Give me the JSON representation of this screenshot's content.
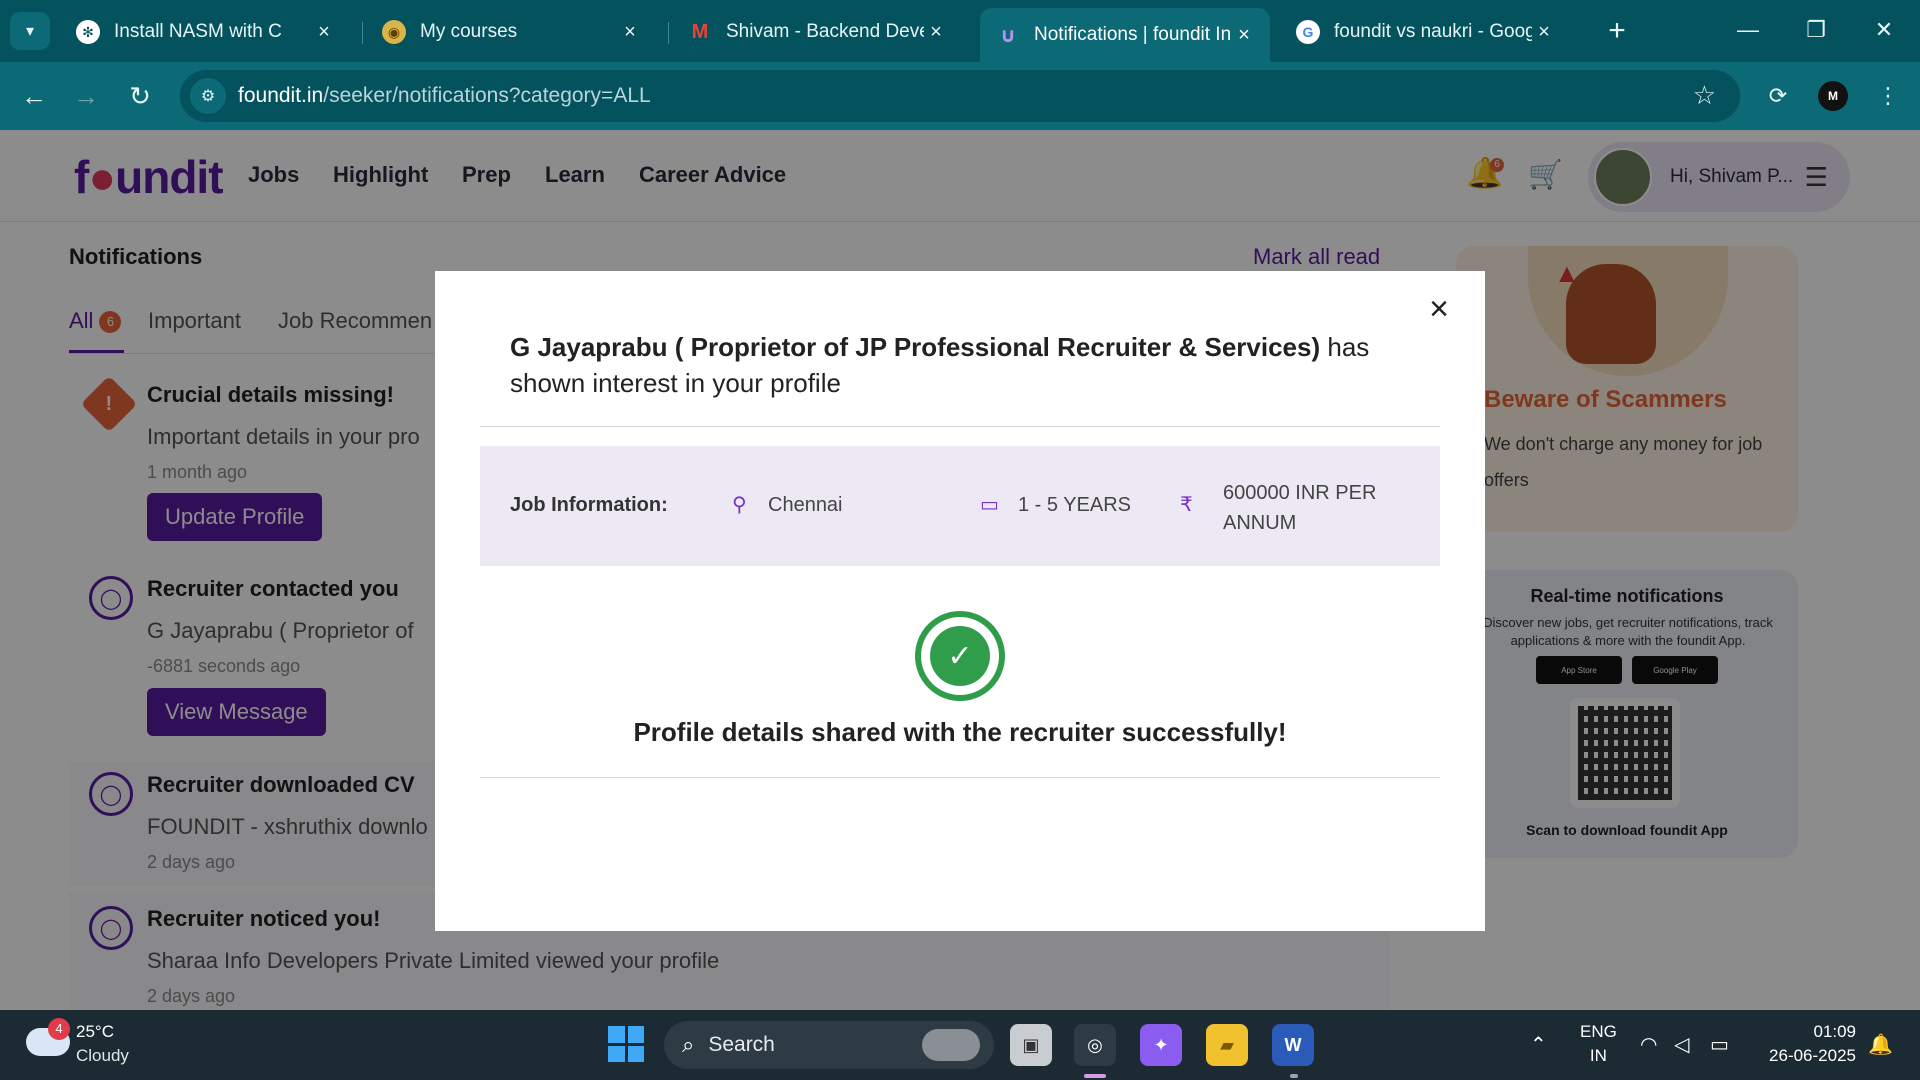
{
  "browser": {
    "tabs": [
      {
        "title": "Install NASM with C",
        "favicon": "openai-icon",
        "active": false
      },
      {
        "title": "My courses",
        "favicon": "courses-icon",
        "active": false
      },
      {
        "title": "Shivam - Backend Develo",
        "favicon": "gmail-icon",
        "active": false
      },
      {
        "title": "Notifications | foundit Inc",
        "favicon": "foundit-icon",
        "active": true
      },
      {
        "title": "foundit vs naukri - Googl",
        "favicon": "google-icon",
        "active": false
      }
    ],
    "url_host": "foundit.in",
    "url_path": "/seeker/notifications?category=ALL"
  },
  "site": {
    "logo": {
      "pre": "f",
      "dot": "●",
      "post": "undit"
    },
    "nav": [
      "Jobs",
      "Highlight",
      "Prep",
      "Learn",
      "Career Advice"
    ],
    "bell_count": "6",
    "greeting": "Hi, Shivam P..."
  },
  "notifications": {
    "title": "Notifications",
    "mark_all_read": "Mark all read",
    "tabs": {
      "all": "All",
      "all_count": "6",
      "important": "Important",
      "job_recs": "Job Recommen"
    },
    "items": [
      {
        "icon": "warning-icon",
        "head": "Crucial details missing!",
        "body": "Important details in your pro",
        "time": "1 month ago",
        "button": "Update Profile"
      },
      {
        "icon": "user-icon",
        "head": "Recruiter contacted you",
        "body": "G Jayaprabu ( Proprietor of",
        "time": "-6881 seconds ago",
        "button": "View Message"
      },
      {
        "icon": "user-icon",
        "head": "Recruiter downloaded CV",
        "body": "FOUNDIT - xshruthix downlo",
        "time": "2 days ago"
      },
      {
        "icon": "user-icon",
        "head": "Recruiter noticed you!",
        "body": "Sharaa Info Developers Private Limited viewed your profile",
        "time": "2 days ago"
      }
    ]
  },
  "sidebar": {
    "scam": {
      "title": "Beware of Scammers",
      "text": "We don't charge any money for job offers"
    },
    "app": {
      "title": "Real-time notifications",
      "text": "Discover new jobs, get recruiter notifications, track applications & more with the foundit App.",
      "app_store": "App Store",
      "google_play": "Google Play",
      "scan": "Scan to download foundit App"
    }
  },
  "modal": {
    "recruiter": "G Jayaprabu ( Proprietor of JP Professional Recruiter & Services)",
    "heading_suffix": " has shown interest in your profile",
    "job_info_label": "Job Information:",
    "location": "Chennai",
    "experience": "1 - 5 YEARS",
    "salary": "600000 INR PER ANNUM",
    "success": "Profile details shared with the recruiter successfully!"
  },
  "taskbar": {
    "weather_badge": "4",
    "temp": "25°C",
    "weather": "Cloudy",
    "search": "Search",
    "lang1": "ENG",
    "lang2": "IN",
    "time": "01:09",
    "date": "26-06-2025"
  },
  "colors": {
    "brand": "#5a1aa0",
    "accent": "#e8663a",
    "success": "#2f9d4a",
    "chrome": "#0b6a76"
  }
}
